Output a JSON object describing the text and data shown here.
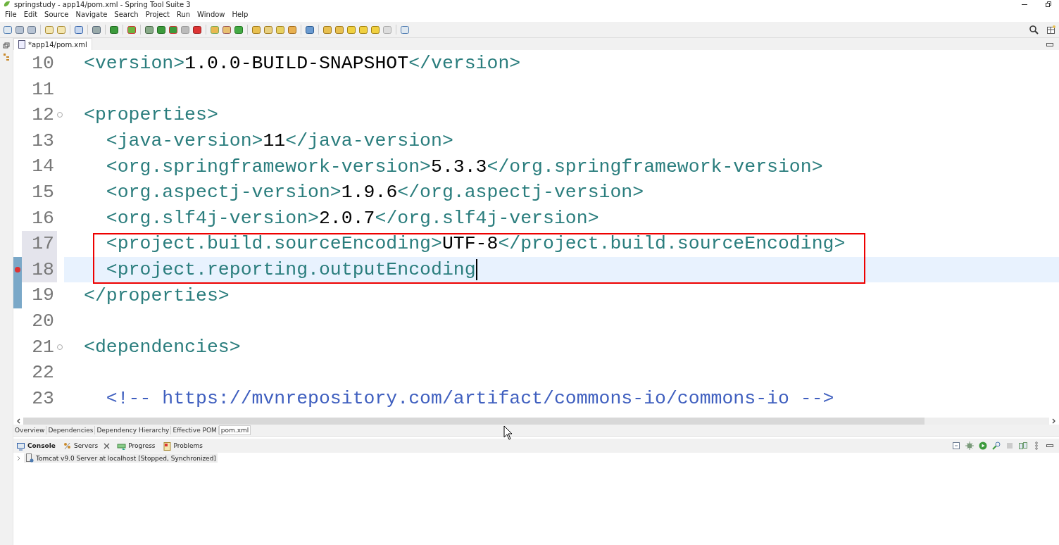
{
  "window": {
    "title": "springstudy - app14/pom.xml - Spring Tool Suite 3"
  },
  "menu": [
    "File",
    "Edit",
    "Source",
    "Navigate",
    "Search",
    "Project",
    "Run",
    "Window",
    "Help"
  ],
  "editor_tabs": [
    {
      "label": "*app14/pom.xml",
      "selected": true
    }
  ],
  "lines": [
    {
      "number": "10",
      "fold": false,
      "error": false,
      "current": false,
      "selected": false,
      "changed": false,
      "tokens": [
        {
          "kind": "tag",
          "text": "<version>"
        },
        {
          "kind": "text",
          "text": "1.0.0-BUILD-SNAPSHOT"
        },
        {
          "kind": "tag",
          "text": "</version>"
        }
      ]
    },
    {
      "number": "11",
      "fold": false,
      "error": false,
      "current": false,
      "selected": false,
      "changed": false
    },
    {
      "number": "12",
      "fold": true,
      "error": false,
      "current": false,
      "selected": false,
      "changed": false,
      "tokens": [
        {
          "kind": "tag",
          "text": "<properties>"
        }
      ]
    },
    {
      "number": "13",
      "fold": false,
      "error": false,
      "current": false,
      "selected": false,
      "changed": false,
      "tokens": [
        {
          "kind": "tag",
          "text": "  <java-version>"
        },
        {
          "kind": "text",
          "text": "11"
        },
        {
          "kind": "tag",
          "text": "</java-version>"
        }
      ]
    },
    {
      "number": "14",
      "fold": false,
      "error": false,
      "current": false,
      "selected": false,
      "changed": false,
      "tokens": [
        {
          "kind": "tag",
          "text": "  <org.springframework-version>"
        },
        {
          "kind": "text",
          "text": "5.3.3"
        },
        {
          "kind": "tag",
          "text": "</org.springframework-version>"
        }
      ]
    },
    {
      "number": "15",
      "fold": false,
      "error": false,
      "current": false,
      "selected": false,
      "changed": false,
      "tokens": [
        {
          "kind": "tag",
          "text": "  <org.aspectj-version>"
        },
        {
          "kind": "text",
          "text": "1.9.6"
        },
        {
          "kind": "tag",
          "text": "</org.aspectj-version>"
        }
      ]
    },
    {
      "number": "16",
      "fold": false,
      "error": false,
      "current": false,
      "selected": false,
      "changed": false,
      "tokens": [
        {
          "kind": "tag",
          "text": "  <org.slf4j-version>"
        },
        {
          "kind": "text",
          "text": "2.0.7"
        },
        {
          "kind": "tag",
          "text": "</org.slf4j-version>"
        }
      ]
    },
    {
      "number": "17",
      "fold": false,
      "error": false,
      "current": false,
      "selected": true,
      "changed": false,
      "tokens": [
        {
          "kind": "tag",
          "text": "  <project.build.sourceEncoding>"
        },
        {
          "kind": "text",
          "text": "UTF-8"
        },
        {
          "kind": "tag",
          "text": "</project.build.sourceEncoding>"
        }
      ]
    },
    {
      "number": "18",
      "fold": false,
      "error": true,
      "current": true,
      "selected": true,
      "changed": true,
      "tokens": [
        {
          "kind": "tag",
          "text": "  <project.reporting.outputEncoding"
        }
      ]
    },
    {
      "number": "19",
      "fold": false,
      "error": false,
      "current": false,
      "selected": false,
      "changed": true,
      "tokens": [
        {
          "kind": "tag",
          "text": "</properties>"
        }
      ]
    },
    {
      "number": "20",
      "fold": false,
      "error": false,
      "current": false,
      "selected": false,
      "changed": false
    },
    {
      "number": "21",
      "fold": true,
      "error": false,
      "current": false,
      "selected": false,
      "changed": false,
      "tokens": [
        {
          "kind": "tag",
          "text": "<dependencies>"
        }
      ]
    },
    {
      "number": "22",
      "fold": false,
      "error": false,
      "current": false,
      "selected": false,
      "changed": false
    },
    {
      "number": "23",
      "fold": false,
      "error": false,
      "current": false,
      "selected": false,
      "changed": false,
      "tokens": [
        {
          "kind": "comment",
          "text": "  <!-- https://mvnrepository.com/artifact/commons-io/commons-io -->"
        }
      ]
    }
  ],
  "page_tabs": [
    {
      "label": "Overview",
      "selected": false
    },
    {
      "label": "Dependencies",
      "selected": false
    },
    {
      "label": "Dependency Hierarchy",
      "selected": false
    },
    {
      "label": "Effective POM",
      "selected": false
    },
    {
      "label": "pom.xml",
      "selected": true
    }
  ],
  "view_tabs": [
    {
      "label": "Console",
      "selected": true,
      "closable": false
    },
    {
      "label": "Servers",
      "selected": false,
      "closable": true
    },
    {
      "label": "Progress",
      "selected": false,
      "closable": false
    },
    {
      "label": "Problems",
      "selected": false,
      "closable": false
    }
  ],
  "servers": [
    {
      "name": "Tomcat v9.0 Server at localhost",
      "status": "[Stopped, Synchronized]"
    }
  ]
}
